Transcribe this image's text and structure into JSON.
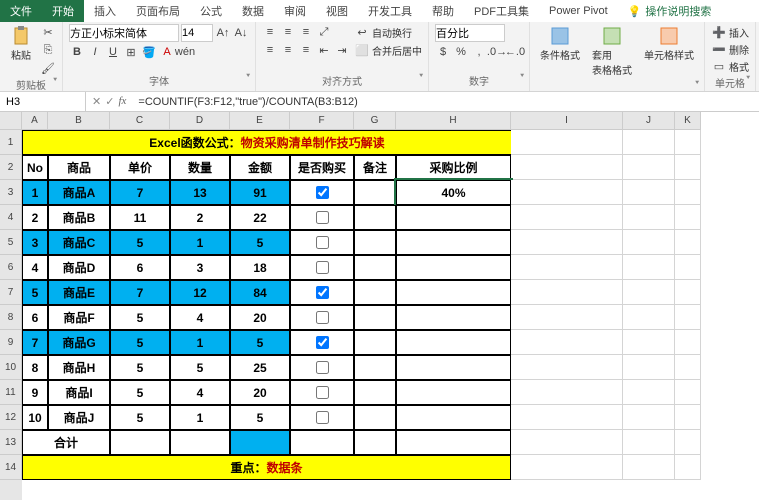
{
  "tabs": {
    "file": "文件",
    "home": "开始",
    "insert": "插入",
    "layout": "页面布局",
    "formulas": "公式",
    "data": "数据",
    "review": "审阅",
    "view": "视图",
    "dev": "开发工具",
    "help": "帮助",
    "pdf": "PDF工具集",
    "pivot": "Power Pivot",
    "tell": "操作说明搜索"
  },
  "ribbon": {
    "clipboard": {
      "paste": "粘贴",
      "label": "剪贴板"
    },
    "font": {
      "name": "方正小标宋简体",
      "size": "14",
      "label": "字体"
    },
    "align": {
      "wrap": "自动换行",
      "merge": "合并后居中",
      "label": "对齐方式"
    },
    "number": {
      "format": "百分比",
      "label": "数字"
    },
    "styles": {
      "cfmt": "条件格式",
      "tfmt": "套用\n表格格式",
      "cstyle": "单元格样式"
    },
    "cells": {
      "insert": "插入",
      "delete": "删除",
      "format": "格式",
      "label": "单元格"
    }
  },
  "namebox": "H3",
  "formula": "=COUNTIF(F3:F12,\"true\")/COUNTA(B3:B12)",
  "cols": [
    "A",
    "B",
    "C",
    "D",
    "E",
    "F",
    "G",
    "H",
    "I",
    "J",
    "K"
  ],
  "title_prefix": "Excel函数公式：",
  "title_red": "物资采购清单制作技巧解读",
  "headers": [
    "No",
    "商品",
    "单价",
    "数量",
    "金额",
    "是否购买",
    "备注",
    "采购比例"
  ],
  "rows": [
    {
      "no": 1,
      "name": "商品A",
      "price": 7,
      "qty": 13,
      "amount": 91,
      "buy": true,
      "blue": true
    },
    {
      "no": 2,
      "name": "商品B",
      "price": 11,
      "qty": 2,
      "amount": 22,
      "buy": false,
      "blue": false
    },
    {
      "no": 3,
      "name": "商品C",
      "price": 5,
      "qty": 1,
      "amount": 5,
      "buy": false,
      "blue": true
    },
    {
      "no": 4,
      "name": "商品D",
      "price": 6,
      "qty": 3,
      "amount": 18,
      "buy": false,
      "blue": false
    },
    {
      "no": 5,
      "name": "商品E",
      "price": 7,
      "qty": 12,
      "amount": 84,
      "buy": true,
      "blue": true
    },
    {
      "no": 6,
      "name": "商品F",
      "price": 5,
      "qty": 4,
      "amount": 20,
      "buy": false,
      "blue": false
    },
    {
      "no": 7,
      "name": "商品G",
      "price": 5,
      "qty": 1,
      "amount": 5,
      "buy": true,
      "blue": true
    },
    {
      "no": 8,
      "name": "商品H",
      "price": 5,
      "qty": 5,
      "amount": 25,
      "buy": false,
      "blue": false
    },
    {
      "no": 9,
      "name": "商品I",
      "price": 5,
      "qty": 4,
      "amount": 20,
      "buy": false,
      "blue": false
    },
    {
      "no": 10,
      "name": "商品J",
      "price": 5,
      "qty": 1,
      "amount": 5,
      "buy": false,
      "blue": false
    }
  ],
  "ratio": "40%",
  "total": "合计",
  "footer_prefix": "重点：",
  "footer_red": "数据条",
  "chart_data": {
    "type": "table",
    "title": "Excel函数公式：物资采购清单制作技巧解读",
    "columns": [
      "No",
      "商品",
      "单价",
      "数量",
      "金额",
      "是否购买",
      "备注",
      "采购比例"
    ],
    "data": [
      [
        1,
        "商品A",
        7,
        13,
        91,
        true,
        "",
        0.4
      ],
      [
        2,
        "商品B",
        11,
        2,
        22,
        false,
        "",
        ""
      ],
      [
        3,
        "商品C",
        5,
        1,
        5,
        false,
        "",
        ""
      ],
      [
        4,
        "商品D",
        6,
        3,
        18,
        false,
        "",
        ""
      ],
      [
        5,
        "商品E",
        7,
        12,
        84,
        true,
        "",
        ""
      ],
      [
        6,
        "商品F",
        5,
        4,
        20,
        false,
        "",
        ""
      ],
      [
        7,
        "商品G",
        5,
        1,
        5,
        true,
        "",
        ""
      ],
      [
        8,
        "商品H",
        5,
        5,
        25,
        false,
        "",
        ""
      ],
      [
        9,
        "商品I",
        5,
        4,
        20,
        false,
        "",
        ""
      ],
      [
        10,
        "商品J",
        5,
        1,
        5,
        false,
        "",
        ""
      ]
    ],
    "annotations": [
      "合计",
      "重点：数据条"
    ]
  }
}
